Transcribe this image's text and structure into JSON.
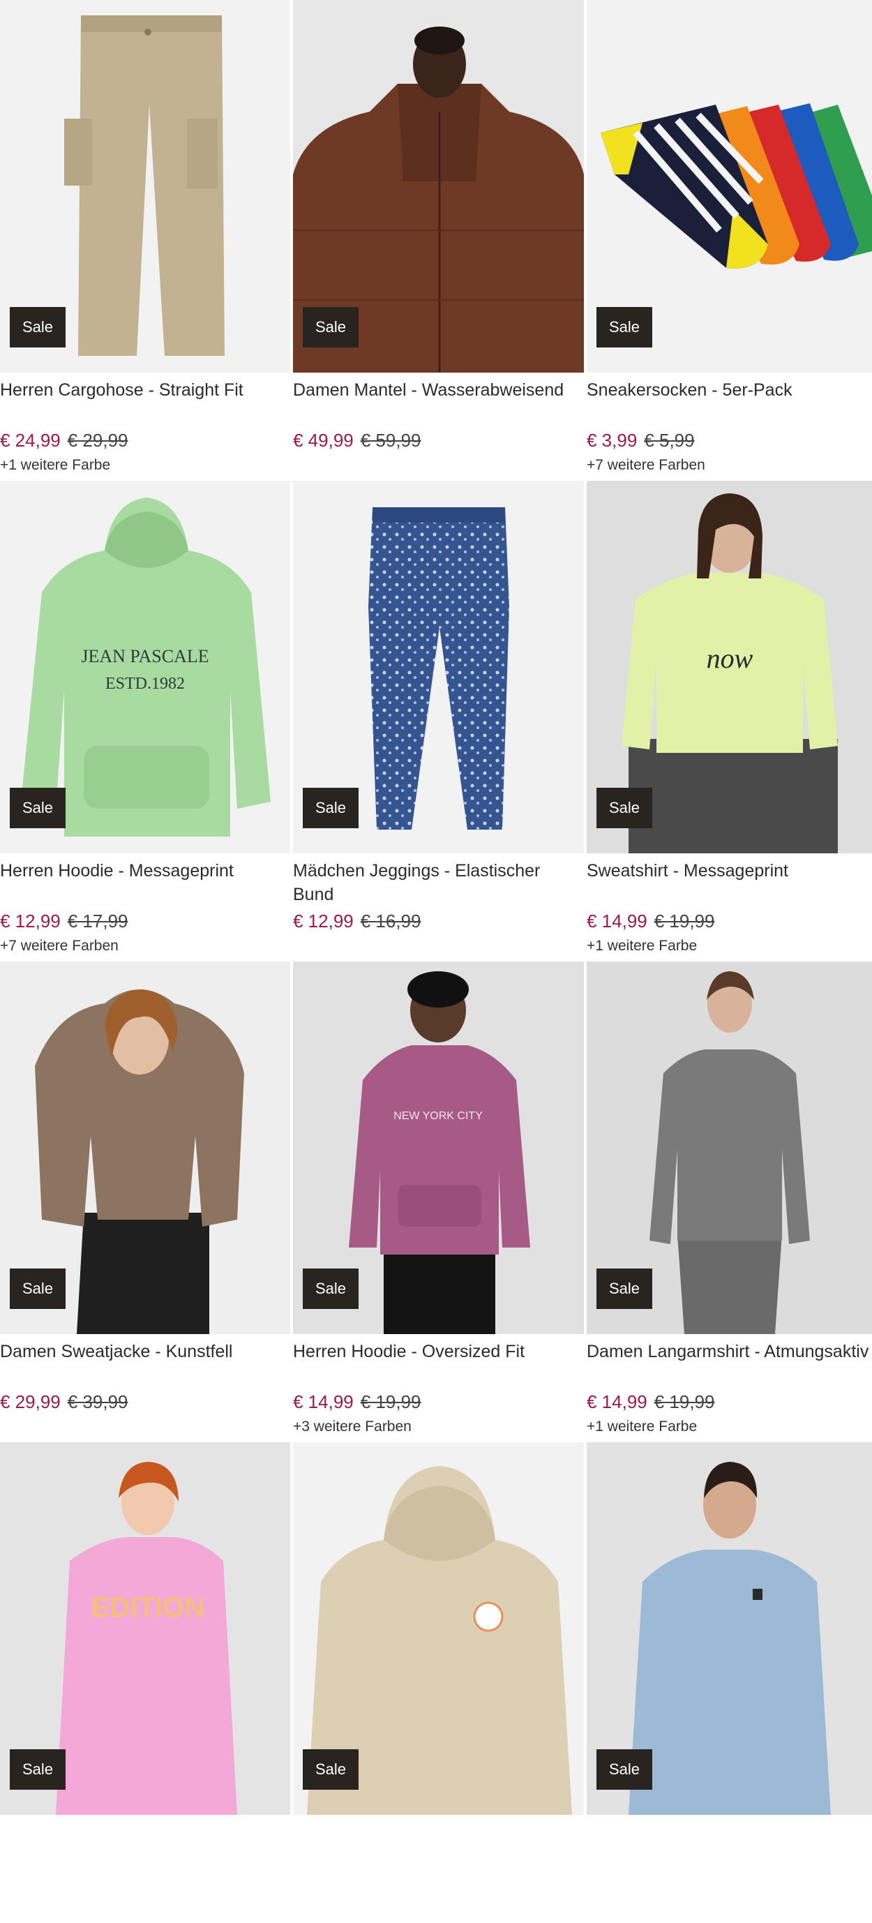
{
  "badge_label": "Sale",
  "colors": {
    "price_now": "#9a1b4b",
    "badge_bg": "#2a2421"
  },
  "products": [
    {
      "title": "Herren Cargohose - Straight Fit",
      "price_now": "€ 24,99",
      "price_old": "€ 29,99",
      "colors_note": "+1 weitere Farbe",
      "image": "cargo-pants-image"
    },
    {
      "title": "Damen Mantel - Wasserabweisend",
      "price_now": "€ 49,99",
      "price_old": "€ 59,99",
      "colors_note": "",
      "image": "puffer-coat-image"
    },
    {
      "title": "Sneakersocken - 5er-Pack",
      "price_now": "€ 3,99",
      "price_old": "€ 5,99",
      "colors_note": "+7 weitere Farben",
      "image": "striped-socks-image"
    },
    {
      "title": "Herren Hoodie - Messageprint",
      "price_now": "€ 12,99",
      "price_old": "€ 17,99",
      "colors_note": "+7 weitere Farben",
      "image": "green-hoodie-image"
    },
    {
      "title": "Mädchen Jeggings - Elastischer Bund",
      "price_now": "€ 12,99",
      "price_old": "€ 16,99",
      "colors_note": "",
      "image": "floral-jeggings-image"
    },
    {
      "title": "Sweatshirt - Messageprint",
      "price_now": "€ 14,99",
      "price_old": "€ 19,99",
      "colors_note": "+1 weitere Farbe",
      "image": "lime-sweatshirt-image"
    },
    {
      "title": "Damen Sweatjacke - Kunstfell",
      "price_now": "€ 29,99",
      "price_old": "€ 39,99",
      "colors_note": "",
      "image": "faux-fur-jacket-image"
    },
    {
      "title": "Herren Hoodie - Oversized Fit",
      "price_now": "€ 14,99",
      "price_old": "€ 19,99",
      "colors_note": "+3 weitere Farben",
      "image": "mauve-hoodie-image"
    },
    {
      "title": "Damen Langarmshirt - Atmungsaktiv",
      "price_now": "€ 14,99",
      "price_old": "€ 19,99",
      "colors_note": "+1 weitere Farbe",
      "image": "grey-longsleeve-image"
    },
    {
      "title": "",
      "price_now": "",
      "price_old": "",
      "colors_note": "",
      "image": "pink-sweatshirt-image"
    },
    {
      "title": "",
      "price_now": "",
      "price_old": "",
      "colors_note": "",
      "image": "beige-hoodie-image"
    },
    {
      "title": "",
      "price_now": "",
      "price_old": "",
      "colors_note": "",
      "image": "blue-knit-sweater-image"
    }
  ]
}
